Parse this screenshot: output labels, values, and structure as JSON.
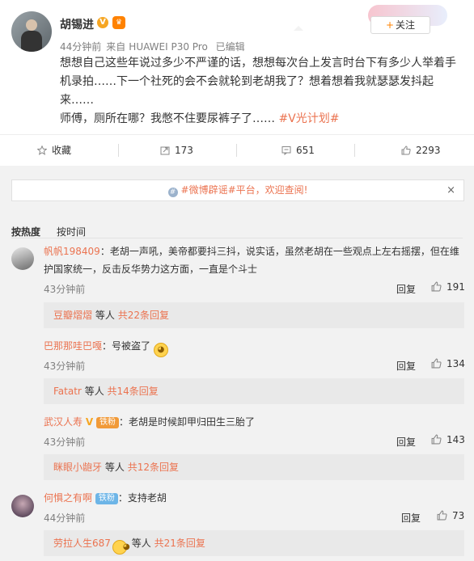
{
  "post": {
    "author": "胡锡进",
    "time": "44分钟前",
    "source_prefix": "来自",
    "device": "HUAWEI P30 Pro",
    "edited": "已编辑",
    "follow_label": "关注",
    "line1": "想想自己这些年说过多少不严谨的话，想想每次台上发言时台下有多少人举着手",
    "line2": "机录拍……下一个社死的会不会就轮到老胡我了？想着想着我就瑟瑟发抖起",
    "line3": "来……",
    "line4_text": "师傅，厕所在哪？我憋不住要尿裤子了……",
    "line4_tag": "#V光计划#"
  },
  "actions": {
    "favorite": "收藏",
    "repost": "173",
    "comment": "651",
    "like": "2293"
  },
  "notice": {
    "tag": "#微博辟谣#平台",
    "text": "，欢迎查阅!",
    "close": "×"
  },
  "sort": {
    "hot": "按热度",
    "time": "按时间"
  },
  "comments": [
    {
      "name": "帆帆198409",
      "text_a": "：老胡一声吼，美帝都要抖三抖，说实话，虽然老胡在一些观点上左右摇摆，但在维",
      "text_b": "护国家统一，反击反华势力这方面，一直是个斗士",
      "time": "43分钟前",
      "reply": "回复",
      "likes": "191",
      "sub_name": "豆瓣熠熠",
      "sub_mid": "等人",
      "sub_count": "共22条回复"
    },
    {
      "name": "巴那那哇巴嘎",
      "text_a": "：号被盗了",
      "time": "43分钟前",
      "reply": "回复",
      "likes": "134",
      "sub_name": "Fatatr",
      "sub_mid": "等人",
      "sub_count": "共14条回复"
    },
    {
      "name": "武汉人寿",
      "badge": "铁粉",
      "text_a": "：老胡是时候卸甲归田生三胎了",
      "time": "43分钟前",
      "reply": "回复",
      "likes": "143",
      "sub_name": "眯眼小龅牙",
      "sub_mid": "等人",
      "sub_count": "共12条回复"
    },
    {
      "name": "何惧之有啊",
      "badge": "铁粉",
      "text_a": "：支持老胡",
      "time": "44分钟前",
      "reply": "回复",
      "likes": "73",
      "sub_name": "劳拉人生687",
      "sub_mid": "等人",
      "sub_count": "共21条回复"
    }
  ]
}
